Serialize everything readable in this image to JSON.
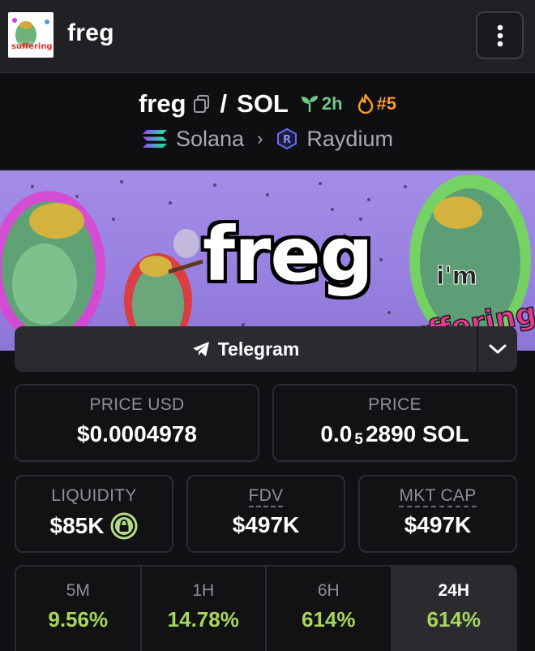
{
  "header": {
    "title": "freg",
    "avatar_text": "suffering"
  },
  "pair": {
    "base": "freg",
    "quote": "SOL",
    "age": "2h",
    "rank": "#5",
    "chain": "Solana",
    "dex": "Raydium"
  },
  "banner": {
    "title": "freg",
    "sticker_top": "i'm",
    "sticker_bottom": "suffering"
  },
  "links": {
    "telegram_label": "Telegram"
  },
  "stats": {
    "price_usd_label": "PRICE USD",
    "price_usd_value": "$0.0004978",
    "price_label": "PRICE",
    "price_prefix": "0.0",
    "price_sub": "5",
    "price_suffix": "2890 SOL",
    "liquidity_label": "LIQUIDITY",
    "liquidity_value": "$85K",
    "fdv_label": "FDV",
    "fdv_value": "$497K",
    "mktcap_label": "MKT CAP",
    "mktcap_value": "$497K"
  },
  "timeframes": [
    {
      "label": "5M",
      "value": "9.56%"
    },
    {
      "label": "1H",
      "value": "14.78%"
    },
    {
      "label": "6H",
      "value": "614%"
    },
    {
      "label": "24H",
      "value": "614%"
    }
  ],
  "colors": {
    "positive": "#a7d65c",
    "age": "#74c686",
    "rank": "#f59b32",
    "background": "#111114"
  }
}
